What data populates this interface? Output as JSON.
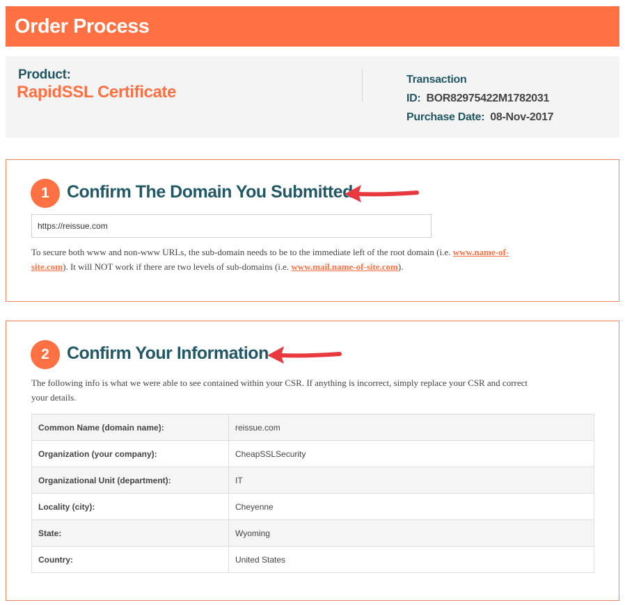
{
  "header": {
    "title": "Order Process"
  },
  "summary": {
    "product_label": "Product:",
    "product_name": "RapidSSL Certificate",
    "transaction_label": "Transaction",
    "id_label": "ID:",
    "id_value": "BOR82975422M1782031",
    "purchase_date_label": "Purchase Date:",
    "purchase_date_value": "08-Nov-2017"
  },
  "step1": {
    "number": "1",
    "title": "Confirm The Domain You Submitted",
    "domain_value": "https://reissue.com",
    "note_part1": "To secure both www and non-www URLs, the sub-domain needs to be to the immediate left of the root domain (i.e. ",
    "note_link1_a": "www.name-of-",
    "note_link1_b": "site.com",
    "note_part2": "). It will NOT work if there are two levels of sub-domains (i.e. ",
    "note_link2": "www.mail.name-of-site.com",
    "note_part3": ")."
  },
  "step2": {
    "number": "2",
    "title": "Confirm Your Information",
    "intro_line1": "The following info is what we were able to see contained within your CSR. If anything is incorrect, simply replace your CSR and correct",
    "intro_line2": "your details.",
    "rows": [
      {
        "label": "Common Name (domain name):",
        "value": "reissue.com"
      },
      {
        "label": "Organization (your company):",
        "value": "CheapSSLSecurity"
      },
      {
        "label": "Organizational Unit (department):",
        "value": "IT"
      },
      {
        "label": "Locality (city):",
        "value": "Cheyenne"
      },
      {
        "label": "State:",
        "value": "Wyoming"
      },
      {
        "label": "Country:",
        "value": "United States"
      }
    ]
  },
  "colors": {
    "accent": "#ff7043",
    "heading": "#225866",
    "annotation_arrow": "#e8393f"
  },
  "icons": {
    "annotation": "red-arrow-icon"
  }
}
